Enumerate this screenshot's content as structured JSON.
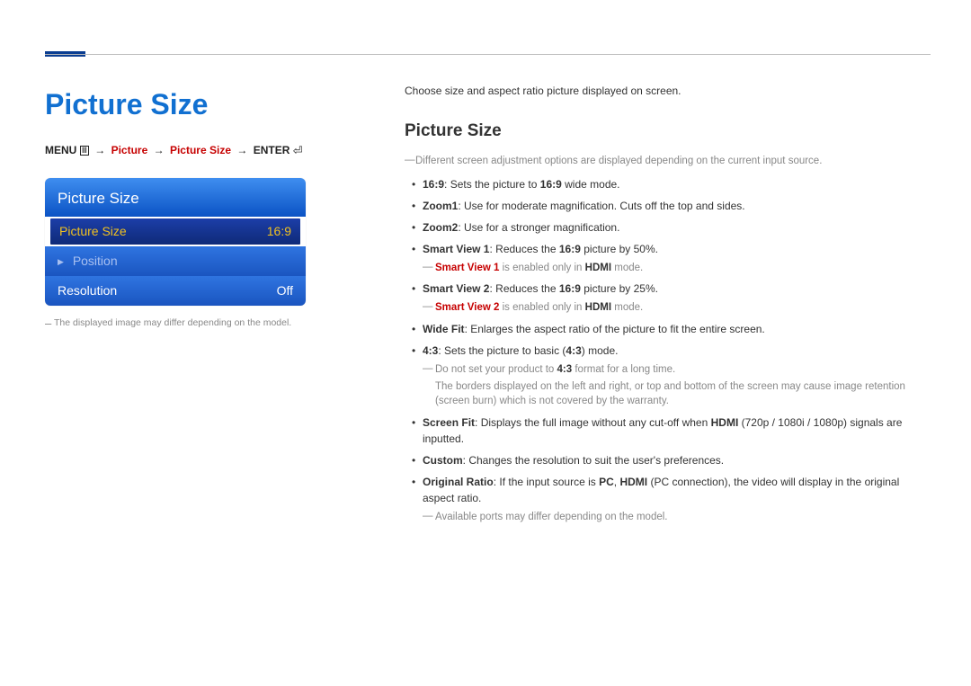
{
  "page": {
    "main_title": "Picture Size",
    "breadcrumb": {
      "menu": "MENU",
      "arrow": "→",
      "picture": "Picture",
      "picture_size": "Picture Size",
      "enter": "ENTER"
    },
    "disclaimer": "The displayed image may differ depending on the model."
  },
  "osd": {
    "title": "Picture Size",
    "rows": [
      {
        "label": "Picture Size",
        "value": "16:9",
        "selected": true
      },
      {
        "label": "Position",
        "value": "",
        "prefix_tri": true,
        "dimmed": true
      },
      {
        "label": "Resolution",
        "value": "Off"
      }
    ]
  },
  "right": {
    "intro": "Choose size and aspect ratio picture displayed on screen.",
    "section_title": "Picture Size",
    "top_note": "Different screen adjustment options are displayed depending on the current input source.",
    "options": {
      "o169": {
        "name": "16:9",
        "desc_a": ": Sets the picture to ",
        "val": "16:9",
        "desc_b": " wide mode."
      },
      "zoom1": {
        "name": "Zoom1",
        "desc": ": Use for moderate magnification. Cuts off the top and sides."
      },
      "zoom2": {
        "name": "Zoom2",
        "desc": ": Use for a stronger magnification."
      },
      "sv1": {
        "name": "Smart View 1",
        "desc_a": ": Reduces the ",
        "val": "16:9",
        "desc_b": " picture by 50%.",
        "note_a": "Smart View 1",
        "note_b": " is enabled only in ",
        "note_c": "HDMI",
        "note_d": " mode."
      },
      "sv2": {
        "name": "Smart View 2",
        "desc_a": ": Reduces the ",
        "val": "16:9",
        "desc_b": " picture by 25%.",
        "note_a": "Smart View 2",
        "note_b": " is enabled only in ",
        "note_c": "HDMI",
        "note_d": " mode."
      },
      "widefit": {
        "name": "Wide Fit",
        "desc": ": Enlarges the aspect ratio of the picture to fit the entire screen."
      },
      "o43": {
        "name": "4:3",
        "desc_a": ": Sets the picture to basic (",
        "val": "4:3",
        "desc_b": ") mode.",
        "warn_a": "Do not set your product to ",
        "warn_b": "4:3",
        "warn_c": " format for a long time.",
        "warn_body": "The borders displayed on the left and right, or top and bottom of the screen may cause image retention (screen burn) which is not covered by the warranty."
      },
      "screenfit": {
        "name": "Screen Fit",
        "desc_a": ": Displays the full image without any cut-off when ",
        "hdmi": "HDMI",
        "desc_b": " (720p / 1080i / 1080p) signals are inputted."
      },
      "custom": {
        "name": "Custom",
        "desc": ": Changes the resolution to suit the user's preferences."
      },
      "original": {
        "name": "Original Ratio",
        "desc_a": ": If the input source is ",
        "pc": "PC",
        "sep": ", ",
        "hdmi": "HDMI",
        "desc_b": " (PC connection), the video will display in the original aspect ratio.",
        "note": "Available ports may differ depending on the model."
      }
    }
  }
}
